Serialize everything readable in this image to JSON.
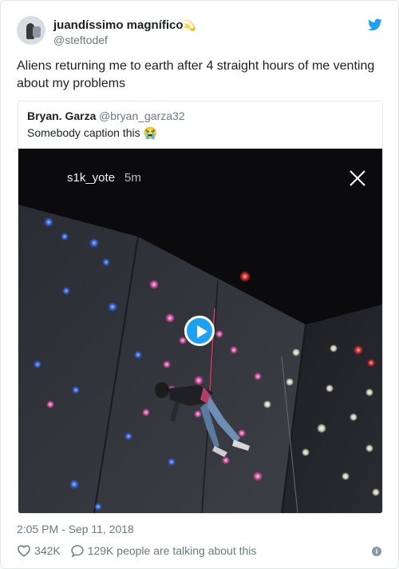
{
  "author": {
    "name": "juandíssimo magnífico",
    "emoji": "💫",
    "handle": "@steftodef"
  },
  "tweet_text": "Aliens returning me to earth after 4 straight hours of me venting about my problems",
  "quoted": {
    "name": "Bryan. Garza",
    "handle": "@bryan_garza32",
    "text": "Somebody caption this",
    "emoji": "😭",
    "media": {
      "story_user": "s1k_yote",
      "story_time": "5m"
    }
  },
  "timestamp": "2:05 PM - Sep 11, 2018",
  "likes": "342K",
  "conversation": "129K people are talking about this",
  "colors": {
    "twitter_blue": "#1da1f2",
    "meta_gray": "#697882"
  },
  "icons": {
    "brand": "twitter-bird-icon",
    "like": "heart-icon",
    "reply": "speech-bubble-icon",
    "info": "info-icon",
    "play": "play-icon",
    "close": "close-icon"
  }
}
